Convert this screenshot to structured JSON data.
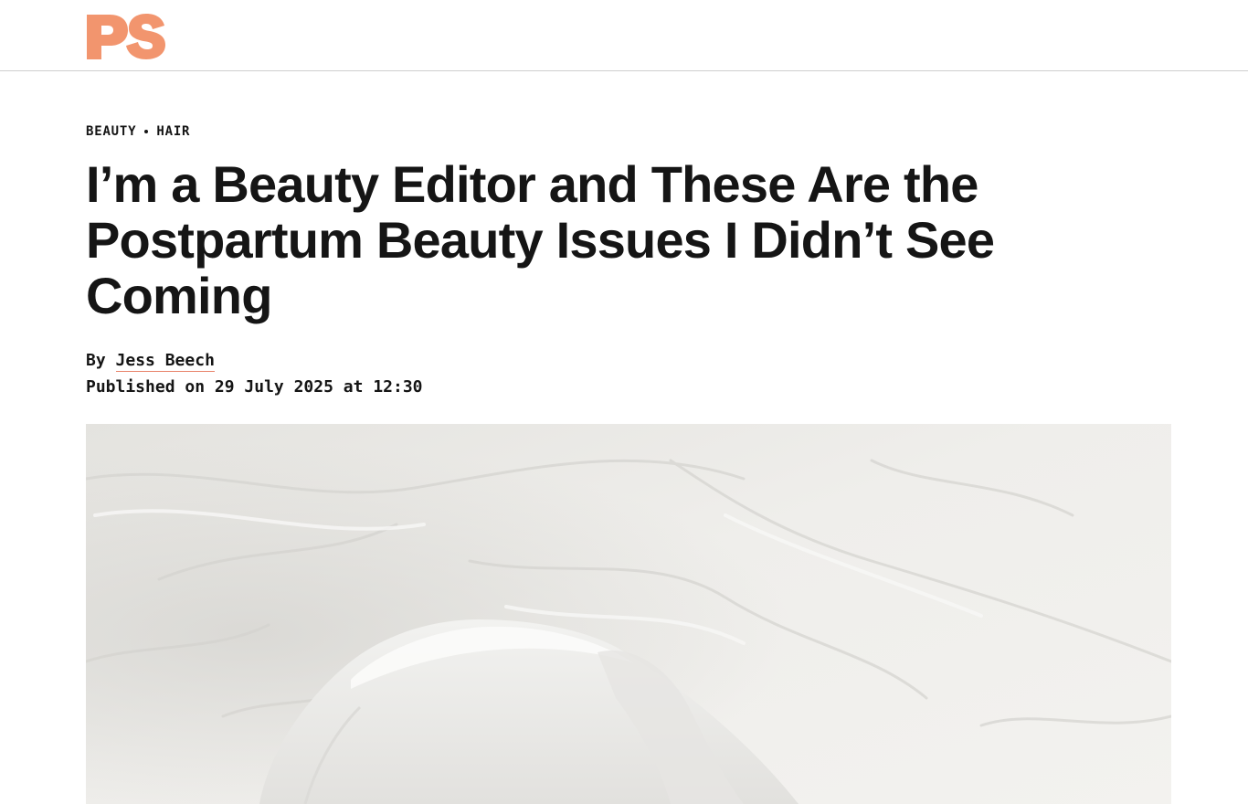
{
  "reading_progress": 0.196,
  "header": {
    "logo_text": "PS",
    "logo_color": "#F2956E"
  },
  "breadcrumb": {
    "items": [
      "BEAUTY",
      "HAIR"
    ]
  },
  "article": {
    "headline": "I’m a Beauty Editor and These Are the Postpartum Beauty Issues I Didn’t See Coming",
    "byline_prefix": "By",
    "author": "Jess Beech",
    "published_prefix": "Published on",
    "published_date": "29 July 2025",
    "published_time_prefix": "at",
    "published_time": "12:30"
  },
  "hero_image": {
    "subject": "white towel on crumpled white bedsheet"
  },
  "colors": {
    "text": "#151515",
    "accent": "#F2956E",
    "divider": "#CFCFCF"
  }
}
